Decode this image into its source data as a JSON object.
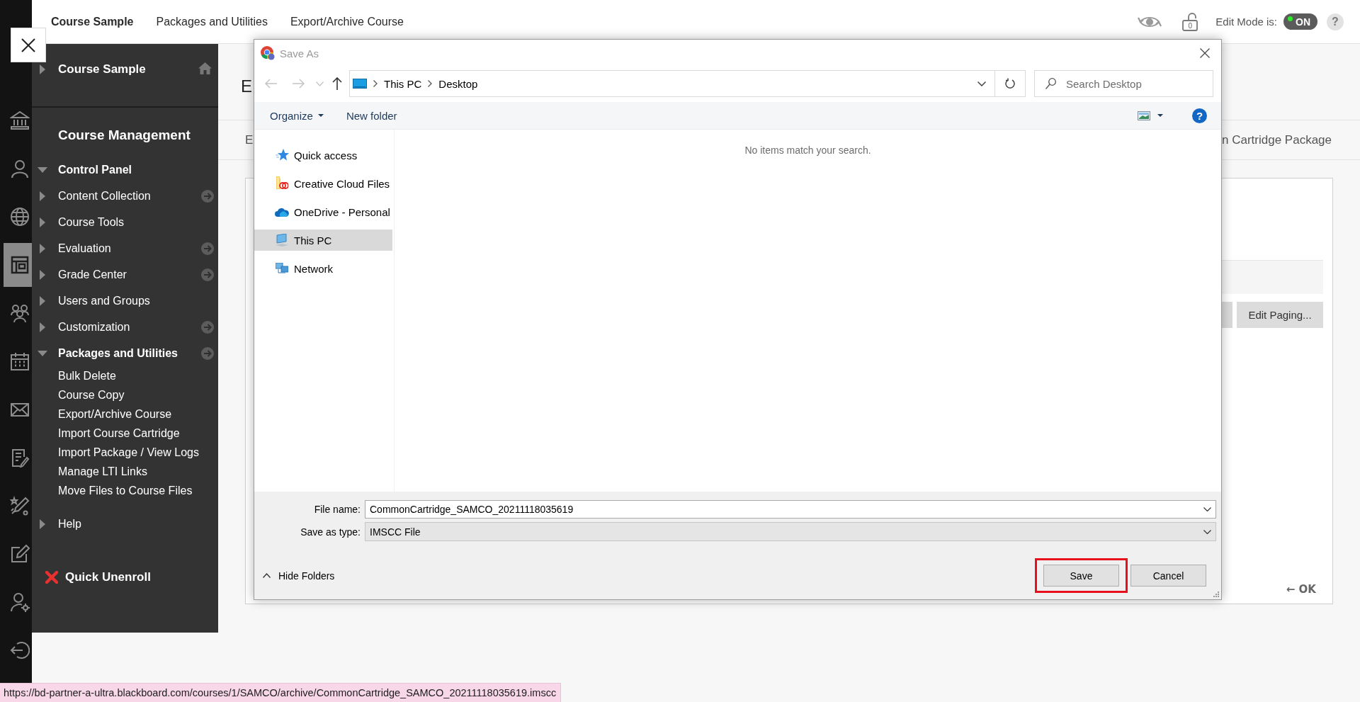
{
  "rail": {
    "items": [
      {
        "selected": false
      },
      {
        "selected": false
      },
      {
        "selected": false
      },
      {
        "selected": true
      },
      {
        "selected": false
      },
      {
        "selected": false
      },
      {
        "selected": false
      },
      {
        "selected": false
      },
      {
        "selected": false
      },
      {
        "selected": false
      },
      {
        "selected": false
      },
      {
        "selected": false
      }
    ]
  },
  "top_bar": {
    "breadcrumbs": [
      {
        "label": "Course Sample",
        "kind": "course"
      },
      {
        "label": "Packages and Utilities",
        "kind": "link"
      },
      {
        "label": "Export/Archive Course",
        "kind": "link"
      }
    ],
    "lock_count": "0",
    "edit_mode": {
      "label": "Edit Mode is:",
      "toggle": "ON",
      "on": true
    },
    "help": "?"
  },
  "sidebar": {
    "course": {
      "title": "Course Sample",
      "expanded": false
    },
    "section_title": "Course Management",
    "menu": [
      {
        "label": "Control Panel",
        "expanded": true,
        "quick_link": false,
        "children": [
          {
            "label": "Content Collection",
            "expanded": false,
            "quick_link": true
          },
          {
            "label": "Course Tools",
            "expanded": false,
            "quick_link": false
          },
          {
            "label": "Evaluation",
            "expanded": false,
            "quick_link": true
          },
          {
            "label": "Grade Center",
            "expanded": false,
            "quick_link": true
          },
          {
            "label": "Users and Groups",
            "expanded": false,
            "quick_link": false
          },
          {
            "label": "Customization",
            "expanded": false,
            "quick_link": true
          },
          {
            "label": "Packages and Utilities",
            "expanded": true,
            "quick_link": true,
            "children": [
              {
                "label": "Bulk Delete"
              },
              {
                "label": "Course Copy"
              },
              {
                "label": "Export/Archive Course"
              },
              {
                "label": "Import Course Cartridge"
              },
              {
                "label": "Import Package / View Logs"
              },
              {
                "label": "Manage LTI Links"
              },
              {
                "label": "Move Files to Course Files"
              }
            ]
          }
        ]
      },
      {
        "label": "Help",
        "expanded": false,
        "quick_link": false
      }
    ],
    "quick_unenroll": "Quick Unenroll"
  },
  "main": {
    "heading": "E",
    "tabs": [
      "E",
      "n Cartridge Package"
    ],
    "edit_paging": "Edit Paging...",
    "ok_link": "← OK"
  },
  "dialog": {
    "title": "Save As",
    "navigation": {
      "back_enabled": false,
      "forward_enabled": false,
      "recent_enabled": false,
      "up_enabled": true
    },
    "address": [
      "This PC",
      "Desktop"
    ],
    "search": {
      "placeholder": "Search Desktop"
    },
    "toolbar": {
      "organize": "Organize",
      "new_folder": "New folder",
      "help": "?"
    },
    "nav": [
      {
        "label": "Quick access",
        "selected": false
      },
      {
        "label": "Creative Cloud Files",
        "selected": false
      },
      {
        "label": "OneDrive - Personal",
        "selected": false
      },
      {
        "label": "This PC",
        "selected": true
      },
      {
        "label": "Network",
        "selected": false
      }
    ],
    "empty_message": "No items match your search.",
    "file_name": {
      "label": "File name:",
      "value": "CommonCartridge_SAMCO_20211118035619"
    },
    "save_as_type": {
      "label": "Save as type:",
      "value": "IMSCC File"
    },
    "hide_folders": "Hide Folders",
    "buttons": [
      {
        "label": "Save",
        "highlighted": true
      },
      {
        "label": "Cancel",
        "highlighted": false
      }
    ]
  },
  "status_bar": {
    "url": "https://bd-partner-a-ultra.blackboard.com/courses/1/SAMCO/archive/CommonCartridge_SAMCO_20211118035619.imscc"
  }
}
